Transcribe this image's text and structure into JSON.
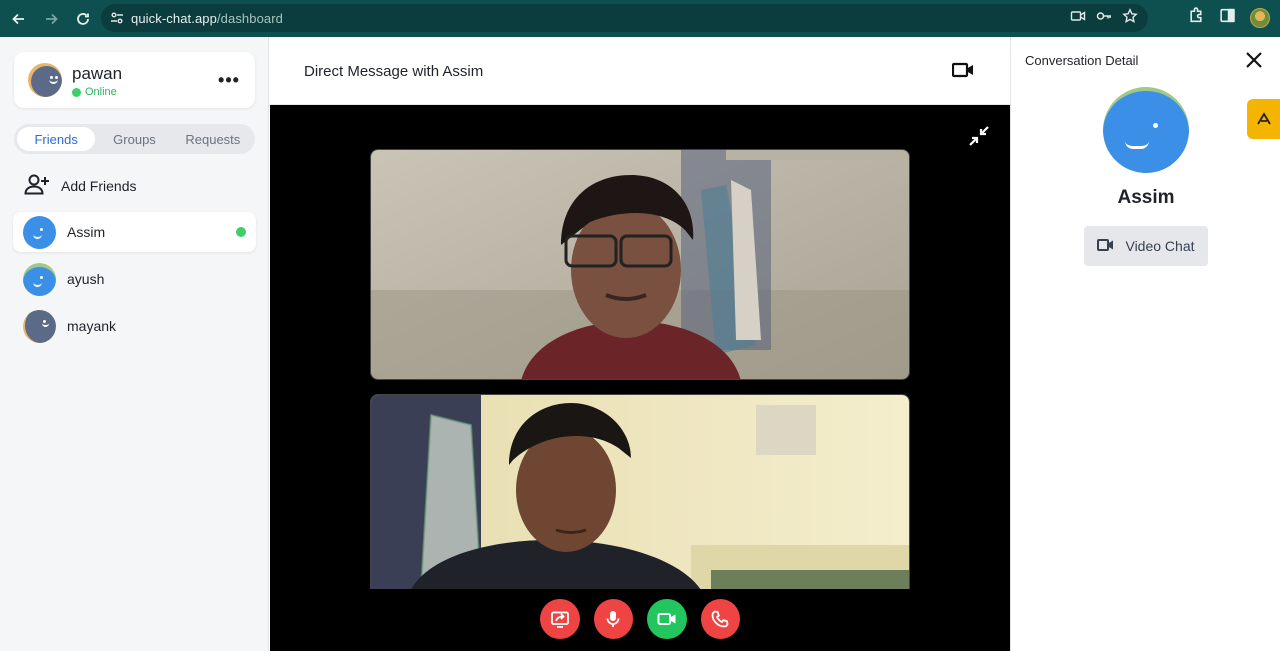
{
  "browser": {
    "url_host": "quick-chat.app",
    "url_path": "/dashboard",
    "icons": [
      "back-icon",
      "forward-icon",
      "reload-icon",
      "site-info-icon",
      "camera-icon",
      "key-icon",
      "star-icon",
      "extensions-icon",
      "sidepanel-icon",
      "profile-avatar"
    ]
  },
  "user": {
    "name": "pawan",
    "status": "Online"
  },
  "sidebar": {
    "tabs": [
      {
        "label": "Friends",
        "active": true
      },
      {
        "label": "Groups",
        "active": false
      },
      {
        "label": "Requests",
        "active": false
      }
    ],
    "add_friends_label": "Add Friends",
    "friends": [
      {
        "name": "Assim",
        "online": true,
        "active": true,
        "avatar_color": "#3b8fe6"
      },
      {
        "name": "ayush",
        "online": false,
        "active": false,
        "avatar_color": "#3b8fe6"
      },
      {
        "name": "mayank",
        "online": false,
        "active": false,
        "avatar_color": "#5b6b87"
      }
    ]
  },
  "conversation": {
    "title": "Direct Message with Assim"
  },
  "call_controls": [
    "screen-share",
    "microphone",
    "camera",
    "end-call"
  ],
  "detail_panel": {
    "title": "Conversation Detail",
    "name": "Assim",
    "video_chat_label": "Video Chat"
  },
  "colors": {
    "accent": "#2d6bd8",
    "online": "#3ecf6a",
    "danger": "#ef4444",
    "success": "#22c55e",
    "chrome": "#0e4f4f"
  }
}
